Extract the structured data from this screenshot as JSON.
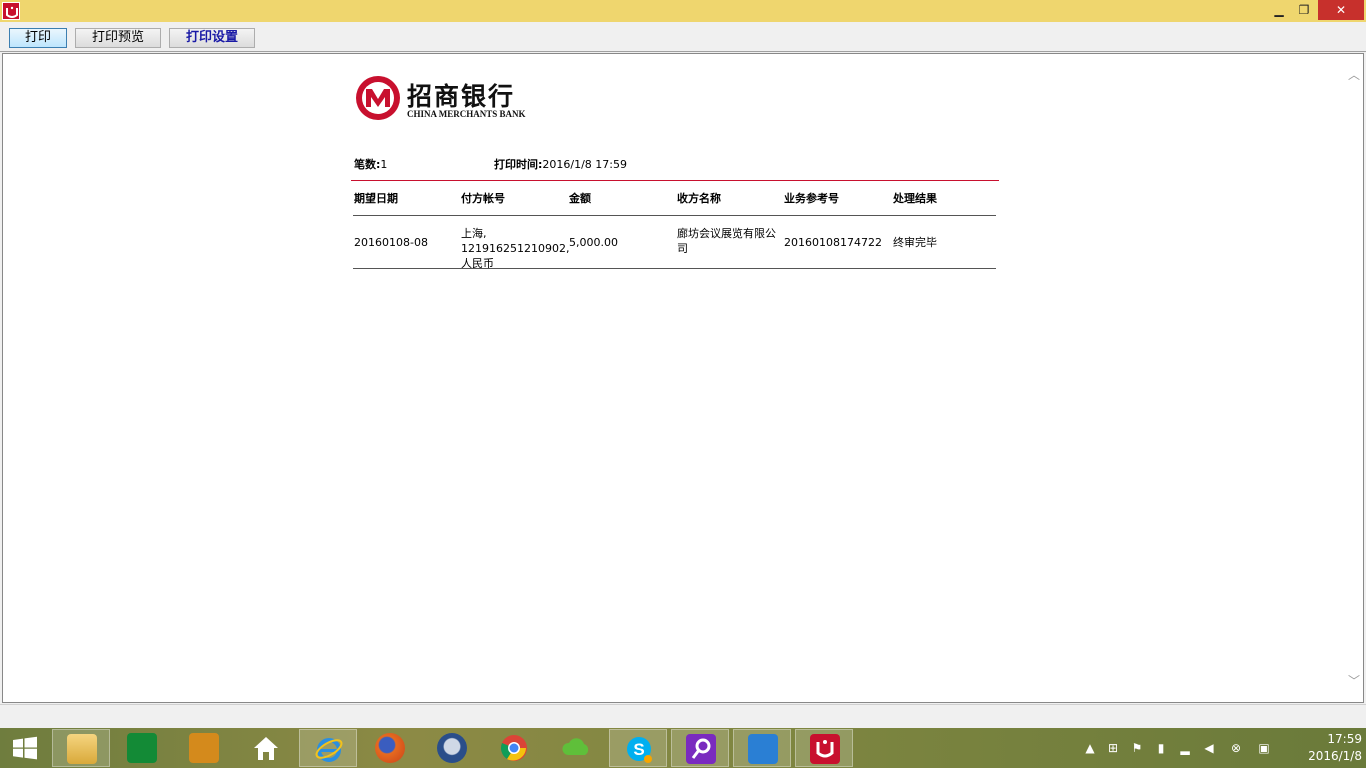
{
  "toolbar": {
    "print": "打印",
    "preview": "打印预览",
    "setup": "打印设置"
  },
  "window_controls": {
    "minimize": "▁",
    "maximize": "❐",
    "close": "✕"
  },
  "logo": {
    "cn": "招商银行",
    "en": "CHINA MERCHANTS BANK"
  },
  "summary": {
    "count_label": "笔数:",
    "count_value": "1",
    "time_label": "打印时间:",
    "time_value": "2016/1/8 17:59"
  },
  "table": {
    "headers": [
      "期望日期",
      "付方帐号",
      "金额",
      "收方名称",
      "业务参考号",
      "处理结果"
    ],
    "rows": [
      [
        "20160108-08",
        "上海, 121916251210902, 人民币",
        "5,000.00",
        "廊坊会议展览有限公司",
        "20160108174722",
        "终审完毕"
      ]
    ]
  },
  "clock": {
    "time": "17:59",
    "date": "2016/1/8"
  },
  "taskbar_icons": [
    "file-explorer",
    "windows-store",
    "notes-app",
    "home",
    "internet-explorer",
    "firefox",
    "thunderbird",
    "chrome",
    "cloud-app",
    "skype",
    "search-app",
    "gj-app",
    "cmb-app"
  ],
  "colors": {
    "titlebar": "#efd66e",
    "brand_red": "#c8102e",
    "close_button": "#c7302c"
  }
}
